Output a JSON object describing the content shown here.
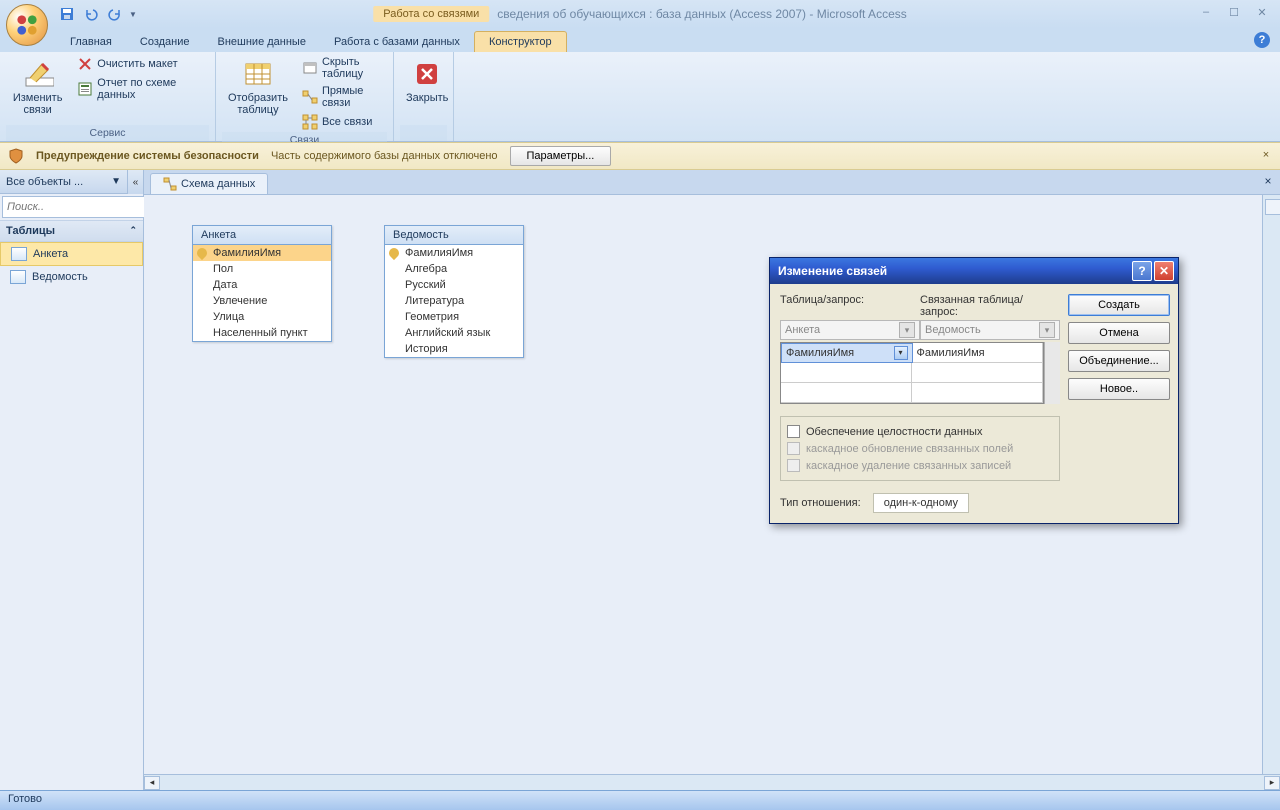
{
  "titlebar": {
    "context_tool": "Работа со связями",
    "app_title": "сведения об обучающихся : база данных (Access 2007) - Microsoft Access"
  },
  "ribbon_tabs": [
    "Главная",
    "Создание",
    "Внешние данные",
    "Работа с базами данных",
    "Конструктор"
  ],
  "ribbon": {
    "g1": {
      "edit_rel": "Изменить связи",
      "clear_layout": "Очистить макет",
      "rel_report": "Отчет по схеме данных",
      "label": "Сервис"
    },
    "g2": {
      "show_table": "Отобразить таблицу",
      "hide_table": "Скрыть таблицу",
      "direct_rel": "Прямые связи",
      "all_rel": "Все связи",
      "label": "Связи"
    },
    "g3": {
      "close": "Закрыть"
    }
  },
  "security": {
    "title": "Предупреждение системы безопасности",
    "msg": "Часть содержимого базы данных отключено",
    "btn": "Параметры..."
  },
  "nav": {
    "header": "Все объекты ...",
    "search_placeholder": "Поиск..",
    "category": "Таблицы",
    "items": [
      "Анкета",
      "Ведомость"
    ]
  },
  "doc_tab": "Схема данных",
  "tables": {
    "anketa": {
      "title": "Анкета",
      "fields": [
        "ФамилияИмя",
        "Пол",
        "Дата",
        "Увлечение",
        "Улица",
        "Населенный пункт"
      ]
    },
    "vedomost": {
      "title": "Ведомость",
      "fields": [
        "ФамилияИмя",
        "Алгебра",
        "Русский",
        "Литература",
        "Геометрия",
        "Английский язык",
        "История"
      ]
    }
  },
  "dialog": {
    "title": "Изменение связей",
    "lbl_table": "Таблица/запрос:",
    "lbl_related": "Связанная таблица/запрос:",
    "combo_left": "Анкета",
    "combo_right": "Ведомость",
    "field_left": "ФамилияИмя",
    "field_right": "ФамилияИмя",
    "chk_integrity": "Обеспечение целостности данных",
    "chk_cascade_update": "каскадное обновление связанных полей",
    "chk_cascade_delete": "каскадное удаление связанных записей",
    "reltype_label": "Тип отношения:",
    "reltype_value": "один-к-одному",
    "btn_create": "Создать",
    "btn_cancel": "Отмена",
    "btn_join": "Объединение...",
    "btn_new": "Новое.."
  },
  "status": "Готово"
}
